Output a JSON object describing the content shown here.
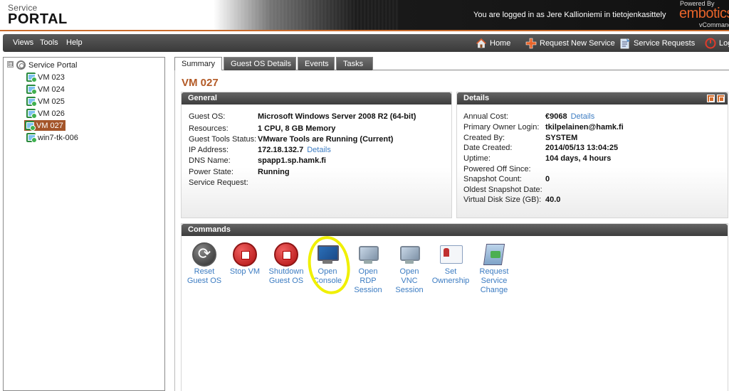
{
  "header": {
    "logo_small": "Service",
    "logo_big": "PORTAL",
    "login_text": "You are logged in as Jere Kallioniemi in tietojenkasittely",
    "powered_by": "Powered By",
    "brand": "embotics",
    "brand_sub": "vCommander",
    "accent_color": "#c96b2c"
  },
  "menubar": {
    "menus": [
      {
        "label": "Views"
      },
      {
        "label": "Tools"
      },
      {
        "label": "Help"
      }
    ],
    "nav": [
      {
        "label": "Home",
        "icon": "home-icon"
      },
      {
        "label": "Request New Service",
        "icon": "plus-icon"
      },
      {
        "label": "Service Requests",
        "icon": "requests-icon"
      },
      {
        "label": "Log",
        "icon": "logout-icon"
      }
    ]
  },
  "tree": {
    "root": {
      "label": "Service Portal",
      "expander": "⊟"
    },
    "items": [
      {
        "label": "VM 023"
      },
      {
        "label": "VM 024"
      },
      {
        "label": "VM 025"
      },
      {
        "label": "VM 026"
      },
      {
        "label": "VM 027",
        "selected": true
      },
      {
        "label": "win7-tk-006"
      }
    ]
  },
  "tabs": [
    {
      "label": "Summary",
      "active": true
    },
    {
      "label": "Guest OS Details",
      "active": false
    },
    {
      "label": "Events",
      "active": false
    },
    {
      "label": "Tasks",
      "active": false
    }
  ],
  "vm_title": "VM 027",
  "general": {
    "title": "General",
    "rows": [
      {
        "label": "Guest OS:",
        "value": "Microsoft Windows Server 2008 R2 (64-bit)"
      },
      {
        "label": "Resources:",
        "value": "1 CPU, 8 GB Memory"
      },
      {
        "label": "Guest Tools Status:",
        "value": "VMware Tools are Running (Current)"
      },
      {
        "label": "IP Address:",
        "value": "172.18.132.7",
        "link": "Details"
      },
      {
        "label": "DNS Name:",
        "value": "spapp1.sp.hamk.fi"
      },
      {
        "label": "Power State:",
        "value": "Running"
      },
      {
        "label": "Service Request:",
        "value": ""
      }
    ]
  },
  "details": {
    "title": "Details",
    "rows": [
      {
        "label": "Annual Cost:",
        "value": "€9068",
        "link": "Details"
      },
      {
        "label": "Primary Owner Login:",
        "value": "tkilpelainen@hamk.fi"
      },
      {
        "label": "Created By:",
        "value": "SYSTEM"
      },
      {
        "label": "Date Created:",
        "value": "2014/05/13 13:04:25"
      },
      {
        "label": "Uptime:",
        "value": "104 days, 4 hours"
      },
      {
        "label": "Powered Off Since:",
        "value": ""
      },
      {
        "label": "Snapshot Count:",
        "value": "0"
      },
      {
        "label": "Oldest Snapshot Date:",
        "value": ""
      },
      {
        "label": "Virtual Disk Size (GB):",
        "value": "40.0"
      }
    ]
  },
  "commands": {
    "title": "Commands",
    "items": [
      {
        "line1": "Reset",
        "line2": "Guest OS",
        "line3": "",
        "icon": "reset-icon"
      },
      {
        "line1": "Stop VM",
        "line2": "",
        "line3": "",
        "icon": "stop-icon"
      },
      {
        "line1": "Shutdown",
        "line2": "Guest OS",
        "line3": "",
        "icon": "shutdown-icon"
      },
      {
        "line1": "Open",
        "line2": "Console",
        "line3": "",
        "icon": "console-icon"
      },
      {
        "line1": "Open",
        "line2": "RDP",
        "line3": "Session",
        "icon": "rdp-icon"
      },
      {
        "line1": "Open",
        "line2": "VNC",
        "line3": "Session",
        "icon": "vnc-icon"
      },
      {
        "line1": "Set",
        "line2": "Ownership",
        "line3": "",
        "icon": "ownership-icon"
      },
      {
        "line1": "Request",
        "line2": "Service",
        "line3": "Change",
        "icon": "request-change-icon"
      }
    ]
  },
  "colors": {
    "title_orange": "#b35a26",
    "link_blue": "#3c7cc2",
    "highlight_yellow": "#f0f000"
  }
}
